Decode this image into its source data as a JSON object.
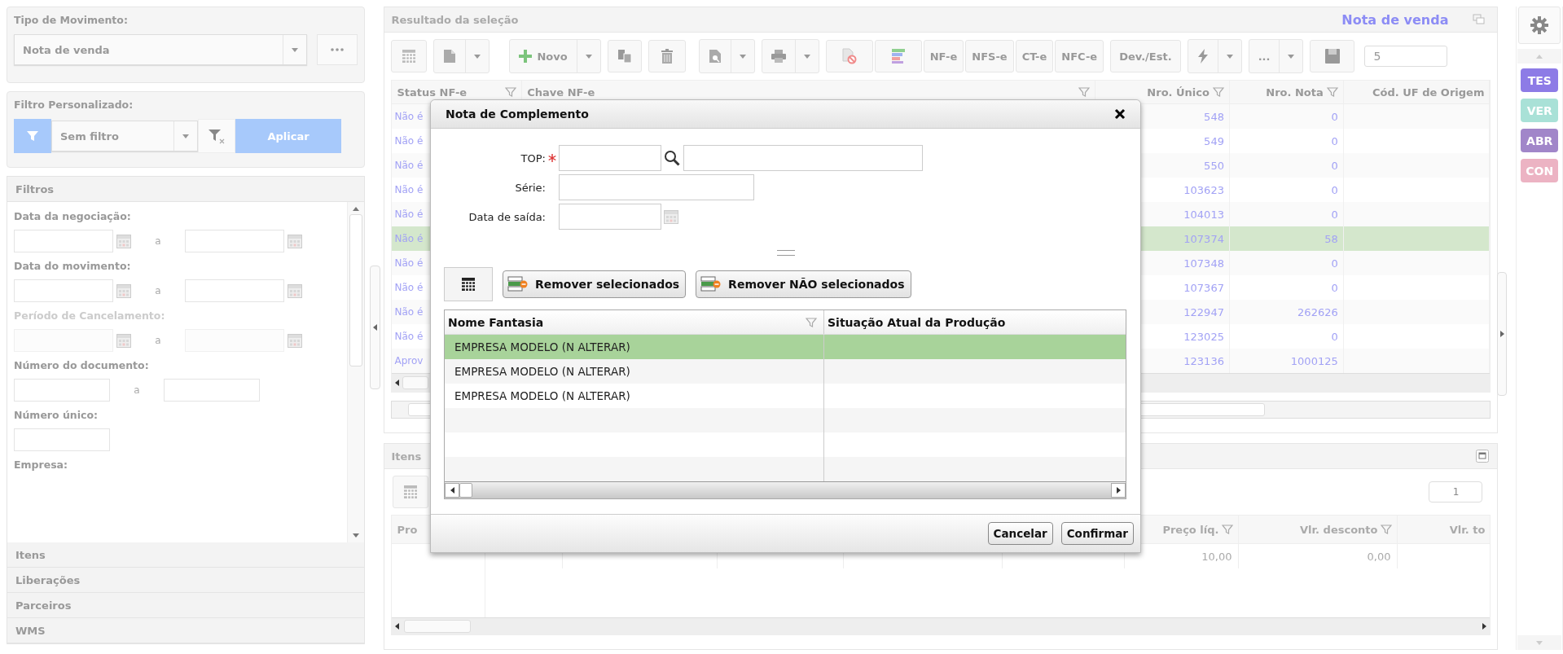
{
  "movement_type": {
    "label": "Tipo de Movimento:",
    "value": "Nota de venda"
  },
  "custom_filter": {
    "label": "Filtro Personalizado:",
    "value": "Sem filtro",
    "apply": "Aplicar"
  },
  "filters": {
    "title": "Filtros",
    "groups": [
      {
        "label": "Data da negociação:",
        "kind": "date_range",
        "disabled": false,
        "separator": "a"
      },
      {
        "label": "Data do movimento:",
        "kind": "date_range",
        "disabled": false,
        "separator": "a"
      },
      {
        "label": "Período de Cancelamento:",
        "kind": "date_range",
        "disabled": true,
        "separator": "a"
      },
      {
        "label": "Número do documento:",
        "kind": "range",
        "disabled": false,
        "separator": "a"
      },
      {
        "label": "Número único:",
        "kind": "single",
        "disabled": false
      },
      {
        "label": "Empresa:",
        "kind": "label",
        "disabled": false
      }
    ]
  },
  "sections": [
    "Itens",
    "Liberações",
    "Parceiros",
    "WMS"
  ],
  "results": {
    "title": "Resultado da seleção",
    "movement": "Nota de venda",
    "toolbar": {
      "new": "Novo",
      "documents": [
        "NF-e",
        "NFS-e",
        "CT-e",
        "NFC-e"
      ],
      "returns": "Dev./Est.",
      "more": "...",
      "page_size": "5"
    },
    "columns": [
      {
        "header": "Status NF-e",
        "filter": true
      },
      {
        "header": "Chave NF-e",
        "filter": true
      },
      {
        "header": "Nro. Único",
        "filter": true
      },
      {
        "header": "Nro. Nota",
        "filter": true
      },
      {
        "header": "Cód. UF de Origem",
        "filter": false
      }
    ],
    "rows": [
      {
        "status": "Não é",
        "unique": "548",
        "note": "0",
        "selected": false
      },
      {
        "status": "Não é",
        "unique": "549",
        "note": "0",
        "selected": false
      },
      {
        "status": "Não é",
        "unique": "550",
        "note": "0",
        "selected": false
      },
      {
        "status": "Não é",
        "unique": "103623",
        "note": "0",
        "selected": false
      },
      {
        "status": "Não é",
        "unique": "104013",
        "note": "0",
        "selected": false
      },
      {
        "status": "Não é",
        "unique": "107374",
        "note": "58",
        "selected": true
      },
      {
        "status": "Não é",
        "unique": "107348",
        "note": "0",
        "selected": false
      },
      {
        "status": "Não é",
        "unique": "107367",
        "note": "0",
        "selected": false
      },
      {
        "status": "Não é",
        "unique": "122947",
        "note": "262626",
        "selected": false
      },
      {
        "status": "Não é",
        "unique": "123025",
        "note": "0",
        "selected": false
      },
      {
        "status": "Aprov",
        "unique": "123136",
        "note": "1000125",
        "selected": false
      }
    ]
  },
  "items": {
    "title": "Itens",
    "page": "1",
    "columns": [
      {
        "header": "Pro",
        "filter": false
      },
      {
        "header": "Preço líq.",
        "filter": true
      },
      {
        "header": "Vlr. desconto",
        "filter": true
      },
      {
        "header": "Vlr. to",
        "filter": false
      }
    ],
    "rows": [
      {
        "price": "10,00",
        "discount": "0,00"
      }
    ]
  },
  "badges": [
    {
      "label": "TES",
      "color": "#8d7be6"
    },
    {
      "label": "VER",
      "color": "#a9e1d7"
    },
    {
      "label": "ABR",
      "color": "#a186c9"
    },
    {
      "label": "CON",
      "color": "#ecb3c3"
    }
  ],
  "dialog": {
    "title": "Nota de Complemento",
    "fields": [
      {
        "label": "TOP:",
        "required": true,
        "kind": "lookup"
      },
      {
        "label": "Série:",
        "required": false,
        "kind": "text"
      },
      {
        "label": "Data de saída:",
        "required": false,
        "kind": "date"
      }
    ],
    "remove_selected": "Remover selecionados",
    "remove_unselected": "Remover NÃO selecionados",
    "columns": [
      {
        "header": "Nome Fantasia",
        "filter": true
      },
      {
        "header": "Situação Atual da Produção",
        "filter": false
      }
    ],
    "rows": [
      {
        "name": "EMPRESA MODELO (N ALTERAR)",
        "selected": true
      },
      {
        "name": "EMPRESA MODELO (N ALTERAR)",
        "selected": false
      },
      {
        "name": "EMPRESA MODELO (N ALTERAR)",
        "selected": false
      }
    ],
    "buttons": [
      "Cancelar",
      "Confirmar"
    ]
  }
}
